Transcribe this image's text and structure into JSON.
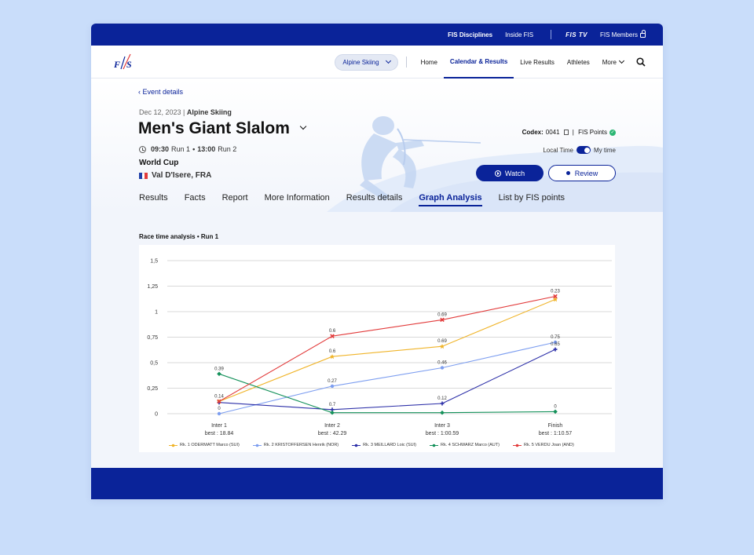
{
  "topbar": {
    "links": [
      "FIS Disciplines",
      "Inside FIS"
    ],
    "tv_label": "FIS TV",
    "members_label": "FIS Members"
  },
  "nav": {
    "discipline_select": "Alpine Skiing",
    "items": [
      "Home",
      "Calendar & Results",
      "Live Results",
      "Athletes",
      "More"
    ],
    "active": "Calendar & Results"
  },
  "event": {
    "back_label": "Event details",
    "date": "Dec 12, 2023",
    "discipline": "Alpine Skiing",
    "title": "Men's Giant Slalom",
    "run1_time": "09:30",
    "run1_label": "Run 1",
    "run2_time": "13:00",
    "run2_label": "Run 2",
    "series": "World Cup",
    "location": "Val D'Isere, FRA",
    "codex_label": "Codex:",
    "codex_value": "0041",
    "fis_points_label": "FIS Points",
    "local_time_label": "Local Time",
    "my_time_label": "My time",
    "watch_label": "Watch",
    "review_label": "Review"
  },
  "tabs": [
    "Results",
    "Facts",
    "Report",
    "More Information",
    "Results details",
    "Graph Analysis",
    "List by FIS points"
  ],
  "active_tab": "Graph Analysis",
  "chart_section_title": "Race time analysis • Run 1",
  "colors": {
    "brand": "#0a2399",
    "background": "#c9ddfa"
  },
  "chart_data": {
    "type": "line",
    "title": "Race time analysis • Run 1",
    "categories": [
      "Inter 1",
      "Inter 2",
      "Inter 3",
      "Finish"
    ],
    "category_sublabels": [
      "best : 18.84",
      "best : 42.29",
      "best : 1:00.59",
      "best : 1:10.57"
    ],
    "y_ticks": [
      "0",
      "0,25",
      "0,5",
      "0,75",
      "1",
      "1,25",
      "1,5"
    ],
    "ylim": [
      0,
      1.5
    ],
    "grid": true,
    "legend_position": "bottom",
    "series": [
      {
        "name": "Rk. 1 ODERMATT Marco (SUI)",
        "color": "#f0b429",
        "marker": "star",
        "values": [
          0.12,
          0.56,
          0.66,
          1.12
        ],
        "labels": [
          "",
          "0.6",
          "0.69",
          ""
        ]
      },
      {
        "name": "Rk. 2 KRISTOFFERSEN Henrik (NOR)",
        "color": "#7d9ef0",
        "marker": "circle",
        "values": [
          0.0,
          0.27,
          0.45,
          0.7
        ],
        "labels": [
          "0",
          "0.27",
          "0.46",
          "0.75"
        ]
      },
      {
        "name": "Rk. 3 MEILLARD Loic (SUI)",
        "color": "#2c2fa8",
        "marker": "cross",
        "values": [
          0.11,
          0.04,
          0.1,
          0.63
        ],
        "labels": [
          "",
          "0.7",
          "0.12",
          "0.65"
        ]
      },
      {
        "name": "Rk. 4 SCHWARZ Marco (AUT)",
        "color": "#14915a",
        "marker": "diamond",
        "values": [
          0.39,
          0.01,
          0.01,
          0.02
        ],
        "labels": [
          "0.39",
          "",
          "",
          "0"
        ]
      },
      {
        "name": "Rk. 5 VERDU Joan (AND)",
        "color": "#e23b3b",
        "marker": "x",
        "values": [
          0.12,
          0.76,
          0.92,
          1.15
        ],
        "labels": [
          "0.14",
          "0.6",
          "0.69",
          "0.23"
        ]
      }
    ]
  }
}
